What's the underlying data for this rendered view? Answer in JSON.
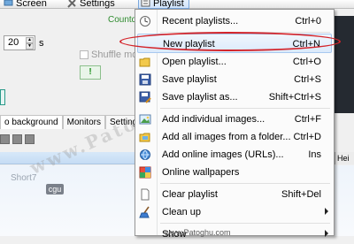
{
  "toolbar": {
    "screen_label": "Screen",
    "settings_label": "Settings",
    "playlist_label": "Playlist"
  },
  "panel": {
    "countdown_label": "Countdo",
    "interval_value": "20",
    "interval_unit": "s",
    "shuffle_label": "Shuffle mo",
    "alert_button_label": "!"
  },
  "tabs": [
    "o background",
    "Monitors",
    "Settings"
  ],
  "list_header": "Hei",
  "list_item_text": "Short7",
  "thumbnail_label": "cgu",
  "menu": {
    "items": [
      {
        "label": "Recent playlists...",
        "shortcut": "Ctrl+0",
        "icon": "clock-icon"
      },
      {
        "label": "New playlist",
        "shortcut": "Ctrl+N",
        "icon": "blank-icon"
      },
      {
        "label": "Open playlist...",
        "shortcut": "Ctrl+O",
        "icon": "folder-icon"
      },
      {
        "label": "Save playlist",
        "shortcut": "Ctrl+S",
        "icon": "floppy-icon"
      },
      {
        "label": "Save playlist as...",
        "shortcut": "Shift+Ctrl+S",
        "icon": "floppy-pen-icon"
      },
      {
        "label": "Add individual images...",
        "shortcut": "Ctrl+F",
        "icon": "image-icon"
      },
      {
        "label": "Add all images from a folder...",
        "shortcut": "Ctrl+D",
        "icon": "folder-images-icon"
      },
      {
        "label": "Add online images (URLs)...",
        "shortcut": "Ins",
        "icon": "globe-icon"
      },
      {
        "label": "Online wallpapers",
        "shortcut": "",
        "icon": "wallpaper-icon"
      },
      {
        "label": "Clear playlist",
        "shortcut": "Shift+Del",
        "icon": "page-icon"
      },
      {
        "label": "Clean up",
        "shortcut": "",
        "icon": "broom-icon"
      },
      {
        "label": "Show",
        "shortcut": "",
        "icon": "blank-icon"
      }
    ]
  },
  "watermark": "www.Patoghu.com",
  "footer_watermark": "www.Patoghu.com",
  "colors": {
    "highlight": "#dbeafb",
    "annotation_ellipse": "#d4242a",
    "countdown_text": "#2e8b2e"
  }
}
